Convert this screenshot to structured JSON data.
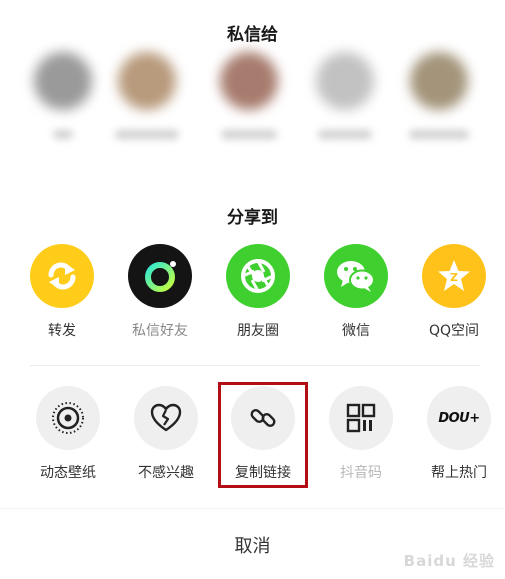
{
  "private_message": {
    "title": "私信给",
    "contacts": [
      {
        "avatar_color": "#9a9a9a"
      },
      {
        "avatar_color": "#b89a7c"
      },
      {
        "avatar_color": "#a77c6e"
      },
      {
        "avatar_color": "#c2c2c2"
      },
      {
        "avatar_color": "#a3947a"
      }
    ]
  },
  "share": {
    "title": "分享到",
    "items": [
      {
        "label": "转发",
        "icon": "repost-icon",
        "color": "#ffcc1a"
      },
      {
        "label": "私信好友",
        "icon": "private-message-icon",
        "color": "#141414"
      },
      {
        "label": "朋友圈",
        "icon": "moments-icon",
        "color": "#3fcf2e"
      },
      {
        "label": "微信",
        "icon": "wechat-icon",
        "color": "#3fcf2e"
      },
      {
        "label": "QQ空间",
        "icon": "qzone-icon",
        "color": "#ffc21a"
      }
    ]
  },
  "actions": {
    "items": [
      {
        "label": "动态壁纸",
        "icon": "live-wallpaper-icon"
      },
      {
        "label": "不感兴趣",
        "icon": "broken-heart-icon"
      },
      {
        "label": "复制链接",
        "icon": "link-icon"
      },
      {
        "label": "抖音码",
        "icon": "qr-code-icon",
        "disabled": true
      },
      {
        "label": "帮上热门",
        "icon": "dou-plus-icon",
        "badge": "DOU+"
      }
    ]
  },
  "cancel_label": "取消",
  "watermark": "Baidu 经验"
}
